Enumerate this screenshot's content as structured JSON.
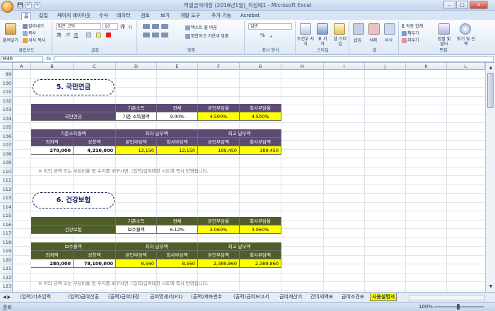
{
  "window": {
    "title": "엑셀급여대장 (2016년1월)_작성예1 - Microsoft Excel",
    "minimize": "–",
    "maximize": "□",
    "close": "✕"
  },
  "quick_access": [
    "💾",
    "↶",
    "↷"
  ],
  "ribbon_tabs": [
    "홈",
    "삽입",
    "페이지 레이아웃",
    "수식",
    "데이터",
    "검토",
    "보기",
    "개발 도구",
    "추가 기능",
    "Acrobat"
  ],
  "ribbon": {
    "clipboard": {
      "paste": "붙여넣기",
      "cut": "잘라내기",
      "copy": "복사",
      "format_painter": "서식 복사",
      "label": "클립보드"
    },
    "font": {
      "name": "맑은 고딕",
      "size": "10",
      "grow": "가",
      "shrink": "가",
      "bold": "가",
      "italic": "가",
      "underline": "가",
      "label": "글꼴"
    },
    "alignment": {
      "wrap": "텍스트 줄 바꿈",
      "merge": "병합하고 가운데 맞춤",
      "label": "맞춤"
    },
    "number": {
      "format": "일반",
      "percent": "%",
      "comma": ",",
      "label": "표시 형식"
    },
    "styles": {
      "conditional": "조건부 서식",
      "table": "표 서식",
      "cell": "셀 스타일",
      "label": "스타일"
    },
    "cells": {
      "insert": "삽입",
      "delete": "삭제",
      "format": "서식",
      "label": "셀"
    },
    "editing": {
      "autosum": "자동 합계",
      "fill": "채우기",
      "clear": "지우기",
      "sort": "정렬 및 필터",
      "find": "찾기 및 선택",
      "label": "편집"
    }
  },
  "formula_bar": {
    "namebox": "M40",
    "fx": "fx",
    "value": ""
  },
  "columns": [
    "A",
    "B",
    "C",
    "D",
    "E",
    "F",
    "G",
    "H",
    "I",
    "J",
    "K",
    "L"
  ],
  "rows": [
    "99",
    "100",
    "101",
    "102",
    "103",
    "104",
    "105",
    "106",
    "107",
    "108",
    "109",
    "110",
    "111",
    "112",
    "113",
    "114",
    "115",
    "116",
    "117",
    "118",
    "119",
    "120",
    "121",
    "122",
    "123"
  ],
  "section5": {
    "title": "5. 국민연금",
    "rate_table": {
      "row_label": "국민연금",
      "headers": [
        "기준소득",
        "전체",
        "본인부담율",
        "회사부담율"
      ],
      "values": [
        "기준 소득월액",
        "9.00%",
        "4.500%",
        "4.500%"
      ]
    },
    "limit_table": {
      "group_headers": [
        "기준소득월액",
        "최저 납부액",
        "최고 납부액"
      ],
      "sub_headers": [
        "최저액",
        "상한액",
        "본인부담액",
        "회사부담액",
        "본인부담액",
        "회사부담액"
      ],
      "values": [
        "270,000",
        "4,210,000",
        "12,150",
        "12,150",
        "189,450",
        "189,450"
      ]
    },
    "note": "※ 위의 금액 또는 부담비율 등 수치를 바꾸시면, (입력)급여대장 시트에 즉시 반영됩니다."
  },
  "section6": {
    "title": "6. 건강보험",
    "rate_table": {
      "row_label": "건강보험",
      "headers": [
        "기준소득",
        "전체",
        "본인부담율",
        "회사부담율"
      ],
      "values": [
        "보수월액",
        "6.12%",
        "3.060%",
        "3.060%"
      ]
    },
    "limit_table": {
      "group_headers": [
        "보수월액",
        "최저 납부액",
        "최고 납부액"
      ],
      "sub_headers": [
        "최저액",
        "상한액",
        "본인부담액",
        "회사부담액",
        "본인부담액",
        "회사부담액"
      ],
      "values": [
        "280,000",
        "78,100,000",
        "8,560",
        "8,560",
        "2,389,860",
        "2,389,860"
      ]
    },
    "note": "※ 위의 금액 또는 부담비율 등 수치를 바꾸시면, (입력)급여대장 시트에 즉시 반영됩니다."
  },
  "sheet_tabs": [
    "(입력)기초입력",
    "(입력)급여산출",
    "(출력)급여대장",
    "급여명세서(F1)",
    "(출력)계좌번호",
    "(출력)급여보고서",
    "급여계산기",
    "간이세액표",
    "급여조견표",
    "사용설명서"
  ],
  "active_sheet": "사용설명서",
  "status": {
    "ready": "준비",
    "zoom": "100%"
  },
  "colors": {
    "purple": "#5c4a73",
    "green": "#4f5e28",
    "yellow": "#ffff00",
    "ribbon": "#dde8f5"
  }
}
